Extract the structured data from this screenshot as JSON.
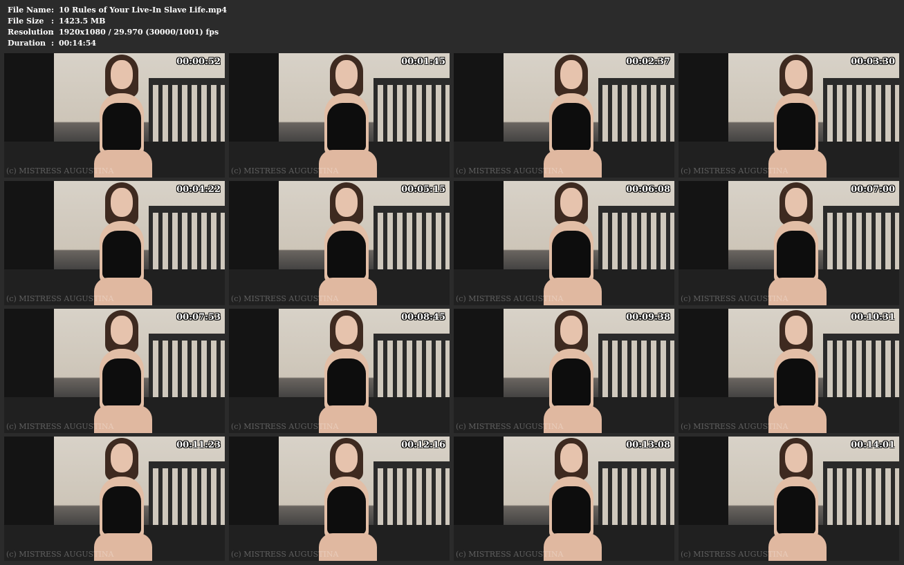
{
  "info": {
    "rows": [
      {
        "label": "File Name",
        "sep": ":",
        "value": "10 Rules of Your Live-In Slave Life.mp4"
      },
      {
        "label": "File Size",
        "sep": ":",
        "value": "1423.5 MB"
      },
      {
        "label": "Resolution",
        "sep": ":",
        "value": "1920x1080 / 29.970 (30000/1001) fps"
      },
      {
        "label": "Duration",
        "sep": ":",
        "value": "00:14:54"
      }
    ]
  },
  "thumbnails": [
    {
      "timestamp": "00:00:52",
      "watermark": "(c) MISTRESS AUGUSTINA"
    },
    {
      "timestamp": "00:01:45",
      "watermark": "(c) MISTRESS AUGUSTINA"
    },
    {
      "timestamp": "00:02:37",
      "watermark": "(c) MISTRESS AUGUSTINA"
    },
    {
      "timestamp": "00:03:30",
      "watermark": "(c) MISTRESS AUGUSTINA"
    },
    {
      "timestamp": "00:04:22",
      "watermark": "(c) MISTRESS AUGUSTINA"
    },
    {
      "timestamp": "00:05:15",
      "watermark": "(c) MISTRESS AUGUSTINA"
    },
    {
      "timestamp": "00:06:08",
      "watermark": "(c) MISTRESS AUGUSTINA"
    },
    {
      "timestamp": "00:07:00",
      "watermark": "(c) MISTRESS AUGUSTINA"
    },
    {
      "timestamp": "00:07:53",
      "watermark": "(c) MISTRESS AUGUSTINA"
    },
    {
      "timestamp": "00:08:45",
      "watermark": "(c) MISTRESS AUGUSTINA"
    },
    {
      "timestamp": "00:09:38",
      "watermark": "(c) MISTRESS AUGUSTINA"
    },
    {
      "timestamp": "00:10:31",
      "watermark": "(c) MISTRESS AUGUSTINA"
    },
    {
      "timestamp": "00:11:23",
      "watermark": "(c) MISTRESS AUGUSTINA"
    },
    {
      "timestamp": "00:12:16",
      "watermark": "(c) MISTRESS AUGUSTINA"
    },
    {
      "timestamp": "00:13:08",
      "watermark": "(c) MISTRESS AUGUSTINA"
    },
    {
      "timestamp": "00:14:01",
      "watermark": "(c) MISTRESS AUGUSTINA"
    }
  ]
}
